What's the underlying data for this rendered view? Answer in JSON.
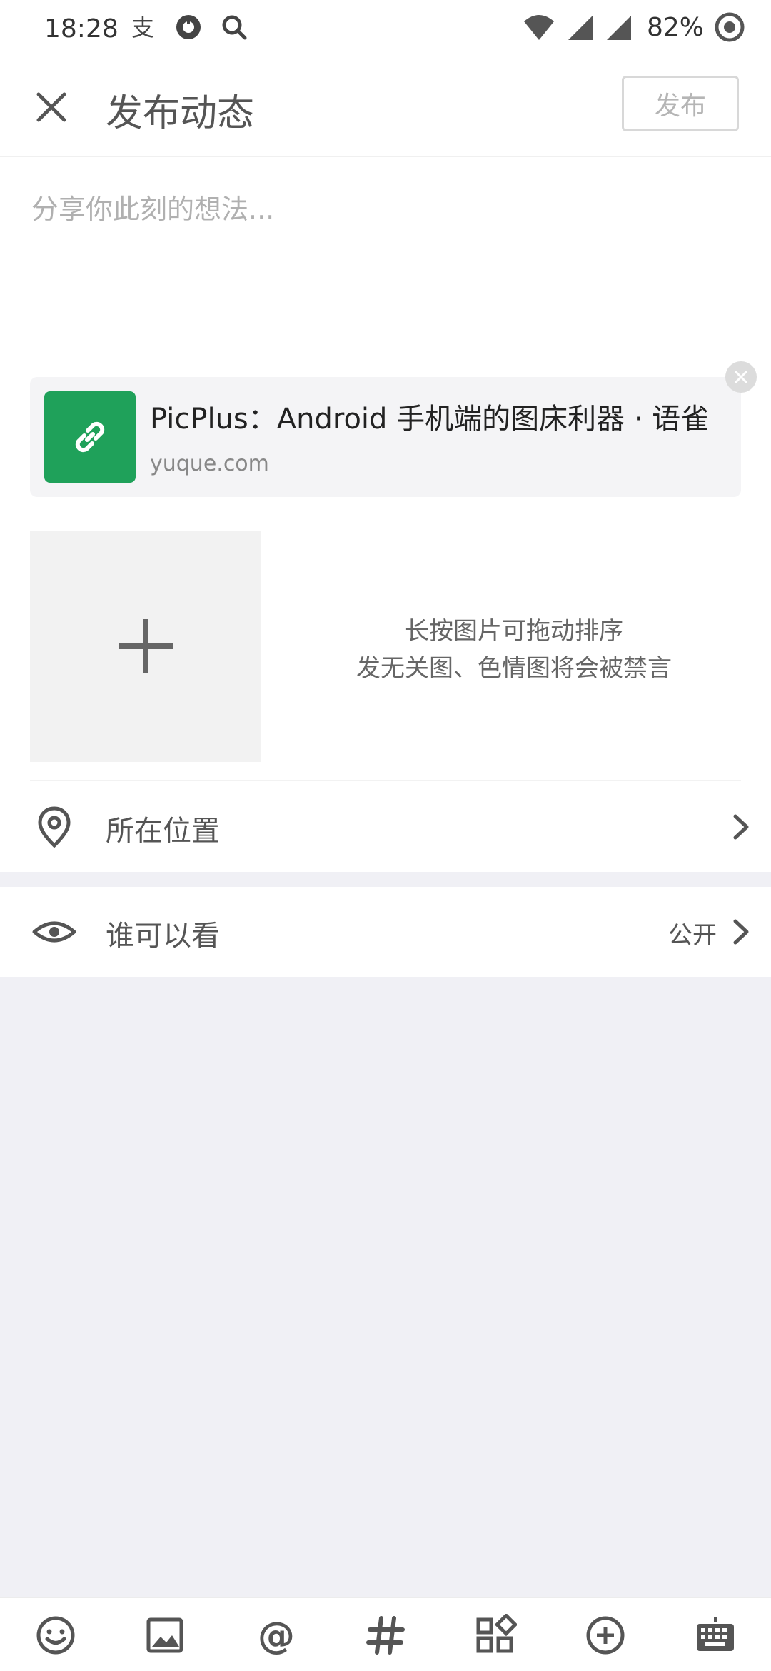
{
  "status_bar": {
    "time": "18:28",
    "battery": "82%"
  },
  "header": {
    "title": "发布动态",
    "publish_label": "发布"
  },
  "composer": {
    "placeholder": "分享你此刻的想法...",
    "value": ""
  },
  "link_card": {
    "title": "PicPlus：Android 手机端的图床利器 · 语雀",
    "domain": "yuque.com",
    "thumb_color": "#1fa15a",
    "thumb_icon": "link-icon"
  },
  "image_hint": {
    "line1": "长按图片可拖动排序",
    "line2": "发无关图、色情图将会被禁言"
  },
  "location_row": {
    "label": "所在位置",
    "icon": "location-pin-icon"
  },
  "visibility_row": {
    "label": "谁可以看",
    "value": "公开",
    "icon": "eye-icon"
  },
  "toolbar": {
    "items": [
      "emoji-icon",
      "image-icon",
      "mention-icon",
      "hashtag-icon",
      "apps-icon",
      "add-circle-icon",
      "keyboard-icon"
    ]
  },
  "colors": {
    "accent_green": "#1fa15a",
    "background": "#f0f0f5"
  }
}
